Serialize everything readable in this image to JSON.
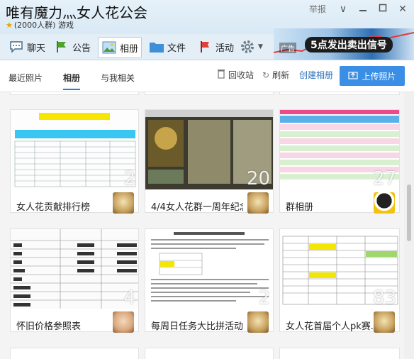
{
  "window": {
    "title": "唯有魔力灬女人花公会",
    "member_count": "(2000人群)",
    "category": "游戏",
    "report_label": "举报",
    "chevron": "∨",
    "minimize": "□",
    "maximize": "□",
    "close": "✕"
  },
  "toolbar": {
    "chat": "聊天",
    "notice": "公告",
    "album": "相册",
    "files": "文件",
    "activity": "活动",
    "settings_icon": "gear-icon"
  },
  "ad": {
    "tag": "广告",
    "text": "5点发出卖出信号"
  },
  "tabs": {
    "recent": "最近照片",
    "albums": "相册",
    "related": "与我相关"
  },
  "actions": {
    "recycle": "回收站",
    "refresh": "刷新",
    "create": "创建相册",
    "upload": "上传照片"
  },
  "albums": [
    {
      "name": "女人花贡献排行榜",
      "count": "2"
    },
    {
      "name": "4/4女人花群一周年纪念",
      "count": "20"
    },
    {
      "name": "群相册",
      "count": "27"
    },
    {
      "name": "怀旧价格参照表",
      "count": "4"
    },
    {
      "name": "每周日任务大比拼活动",
      "count": "2"
    },
    {
      "name": "女人花首届个人pk赛...",
      "count": "83"
    }
  ],
  "colors": {
    "accent": "#3a8ee6",
    "titlebar": "#dceaf5",
    "tab_underline": "#2a79d4"
  }
}
